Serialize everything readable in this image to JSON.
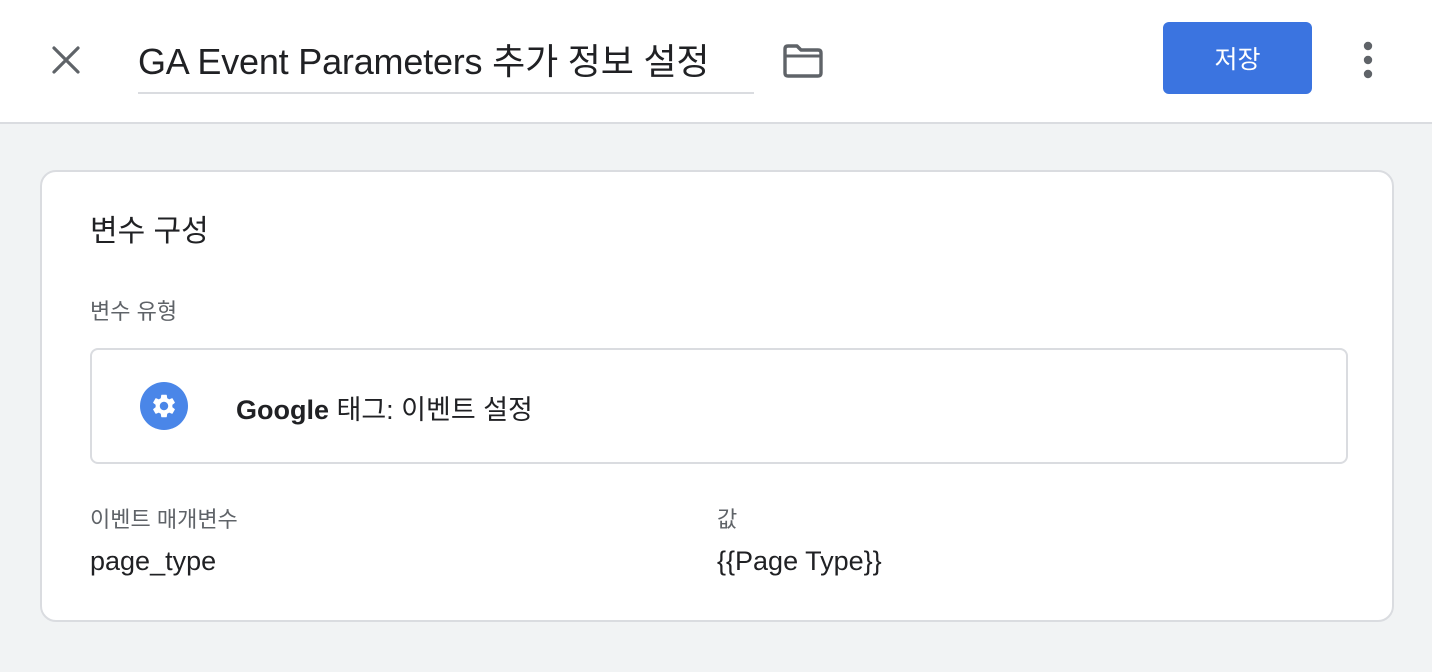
{
  "header": {
    "title": "GA Event Parameters 추가 정보 설정",
    "save_label": "저장",
    "icons": {
      "close": "close-icon",
      "folder": "folder-icon",
      "more": "more-vert-icon"
    }
  },
  "card": {
    "title": "변수 구성",
    "variable_type_label": "변수 유형",
    "variable_type": {
      "icon": "gear-icon",
      "brand": "Google",
      "name": " 태그: 이벤트 설정"
    },
    "table": {
      "headers": [
        "이벤트 매개변수",
        "값"
      ],
      "rows": [
        [
          "page_type",
          "{{Page Type}}"
        ]
      ]
    }
  },
  "colors": {
    "primary": "#3b74e0",
    "icon_blue": "#4a86e8",
    "background": "#f1f3f4",
    "border": "#dadce0"
  }
}
